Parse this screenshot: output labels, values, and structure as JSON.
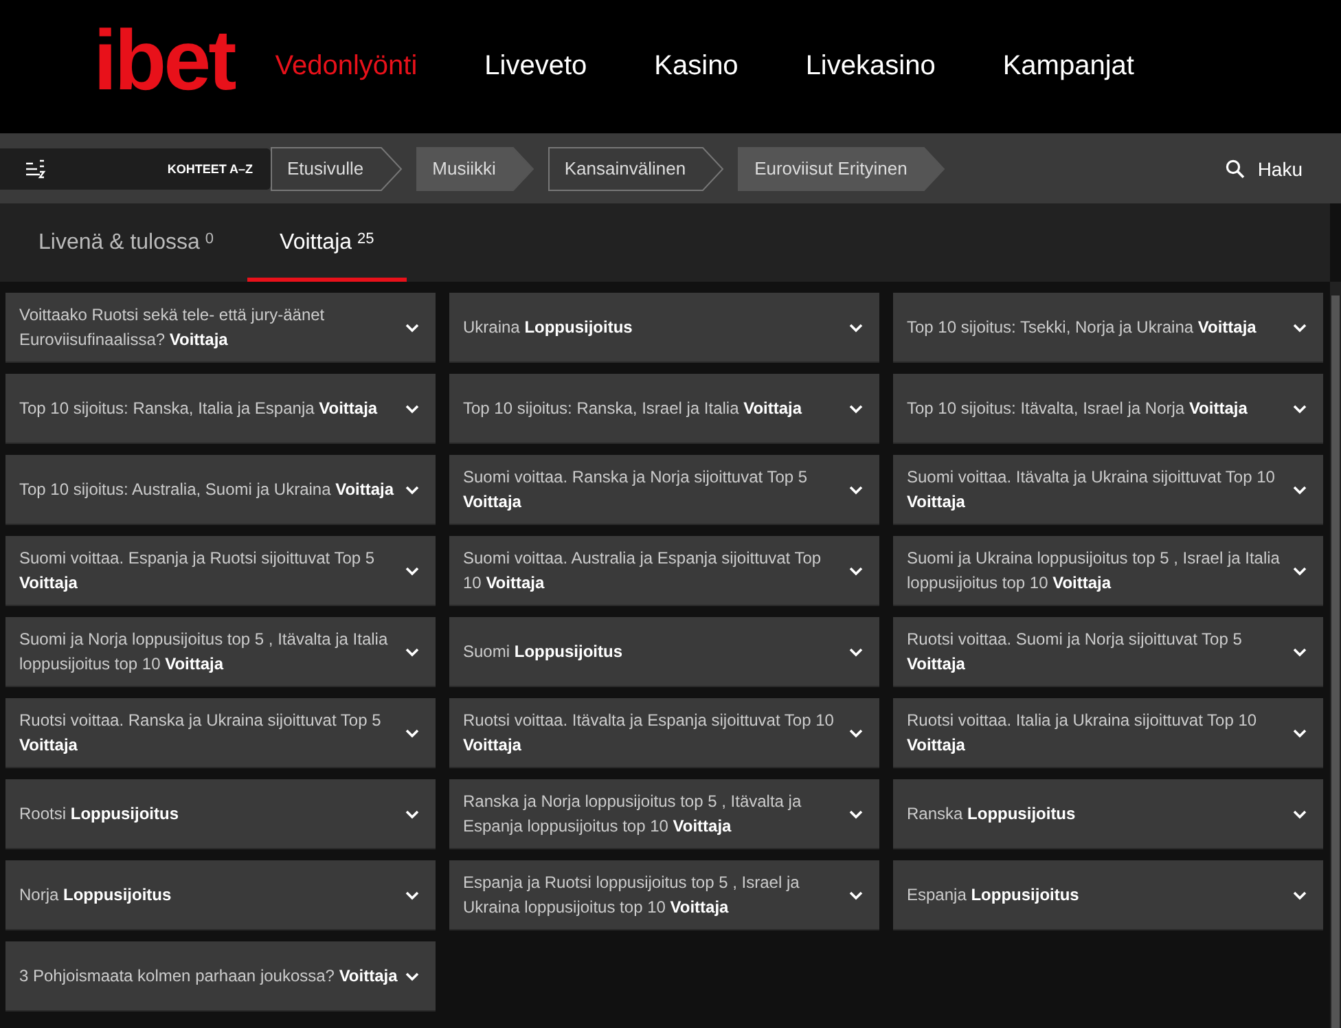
{
  "logo": "ibet",
  "nav": [
    {
      "label": "Vedonlyönti",
      "selected": true
    },
    {
      "label": "Liveveto",
      "selected": false
    },
    {
      "label": "Kasino",
      "selected": false
    },
    {
      "label": "Livekasino",
      "selected": false
    },
    {
      "label": "Kampanjat",
      "selected": false
    }
  ],
  "az_button": "KOHTEET A–Z",
  "breadcrumbs": [
    "Etusivulle",
    "Musiikki",
    "Kansainvälinen",
    "Euroviisut Erityinen"
  ],
  "search": "Haku",
  "tabs": [
    {
      "label": "Livenä & tulossa",
      "count": "0",
      "selected": false
    },
    {
      "label": "Voittaja",
      "count": "25",
      "selected": true
    }
  ],
  "markets": [
    {
      "title": "Voittaako Ruotsi sekä tele- että jury-äänet Euroviisufinaalissa? **Voittaja**",
      "expanded": false
    },
    {
      "title": "Ukraina **Loppusijoitus**",
      "expanded": false
    },
    {
      "title": "Top 10 sijoitus: Tsekki, Norja ja Ukraina **Voittaja**",
      "expanded": false
    },
    {
      "title": "Top 10 sijoitus: Ranska, Italia ja Espanja **Voittaja**",
      "expanded": false
    },
    {
      "title": "Top 10 sijoitus: Ranska, Israel ja Italia **Voittaja**",
      "expanded": false
    },
    {
      "title": "Top 10 sijoitus: Itävalta, Israel ja Norja **Voittaja**",
      "expanded": false
    },
    {
      "title": "Top 10 sijoitus: Australia, Suomi ja Ukraina **Voittaja**",
      "expanded": false
    },
    {
      "title": "Suomi voittaa. Ranska ja Norja sijoittuvat Top 5 **Voittaja**",
      "expanded": false
    },
    {
      "title": "Suomi voittaa. Itävalta ja Ukraina sijoittuvat Top 10 **Voittaja**",
      "expanded": false
    },
    {
      "title": "Suomi voittaa. Espanja ja Ruotsi sijoittuvat Top 5 **Voittaja**",
      "expanded": false
    },
    {
      "title": "Suomi voittaa. Australia ja Espanja sijoittuvat Top 10 **Voittaja**",
      "expanded": false
    },
    {
      "title": "Suomi ja Ukraina loppusijoitus top 5 , Israel ja Italia loppusijoitus top 10 **Voittaja**",
      "expanded": false
    },
    {
      "title": "Suomi ja Norja loppusijoitus top 5 , Itävalta ja Italia loppusijoitus top 10 **Voittaja**",
      "expanded": false
    },
    {
      "title": "Suomi **Loppusijoitus**",
      "expanded": false
    },
    {
      "title": "Ruotsi voittaa. Suomi ja Norja sijoittuvat Top 5 **Voittaja**",
      "expanded": false
    },
    {
      "title": "Ruotsi voittaa. Ranska ja Ukraina sijoittuvat Top 5 **Voittaja**",
      "expanded": false
    },
    {
      "title": "Ruotsi voittaa. Itävalta ja Espanja sijoittuvat Top 10 **Voittaja**",
      "expanded": false
    },
    {
      "title": "Ruotsi voittaa. Italia ja Ukraina sijoittuvat Top 10 **Voittaja**",
      "expanded": false
    },
    {
      "title": "Rootsi **Loppusijoitus**",
      "expanded": false
    },
    {
      "title": "Ranska ja Norja loppusijoitus top 5 , Itävalta ja Espanja loppusijoitus top 10 **Voittaja**",
      "expanded": false
    },
    {
      "title": "Ranska **Loppusijoitus**",
      "expanded": false
    },
    {
      "title": "Norja **Loppusijoitus**",
      "expanded": false
    },
    {
      "title": "Espanja ja Ruotsi loppusijoitus top 5 , Israel ja Ukraina loppusijoitus top 10 **Voittaja**",
      "expanded": false
    },
    {
      "title": "Espanja **Loppusijoitus**",
      "expanded": false
    },
    {
      "title": "3 Pohjoismaata kolmen parhaan joukossa? **Voittaja**",
      "expanded": false
    }
  ]
}
